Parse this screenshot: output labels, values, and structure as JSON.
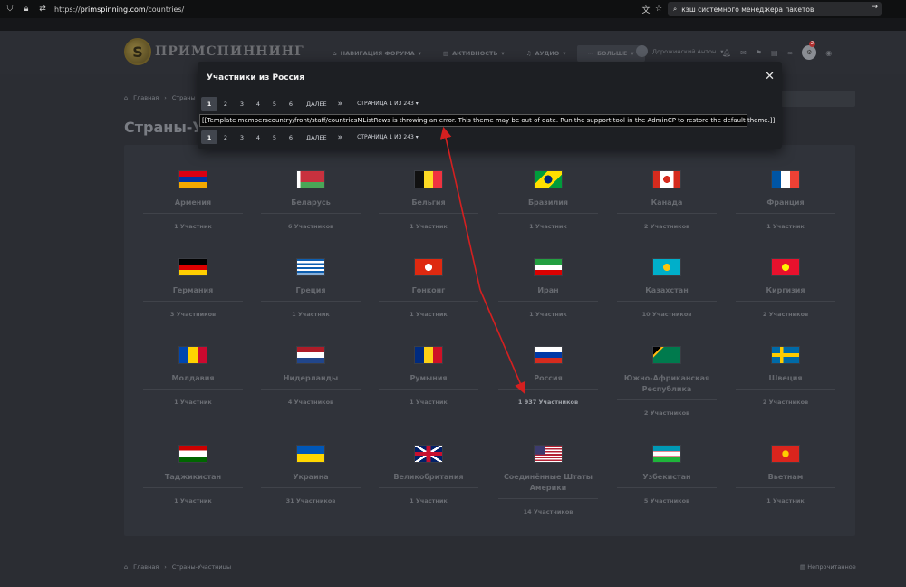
{
  "browser": {
    "url_prefix": "https://",
    "url_host": "primspinning.com",
    "url_path": "/countries/",
    "search_text": "кэш системного менеджера пакетов"
  },
  "site": {
    "logo_text": "ПРИМСПИННИНГ",
    "nav": [
      "НАВИГАЦИЯ ФОРУМА",
      "АКТИВНОСТЬ",
      "АУДИО",
      "БОЛЬШЕ"
    ],
    "user_name": "Дорожинский Антон",
    "badge_count": "2"
  },
  "breadcrumb": {
    "home": "Главная",
    "current": "Страны-Участницы",
    "partial": "Страны"
  },
  "page_title": "Страны-Уча",
  "modal": {
    "title": "Участники из Россия",
    "pages": [
      "1",
      "2",
      "3",
      "4",
      "5",
      "6"
    ],
    "next_label": "ДАЛЕЕ",
    "last_label": "»",
    "page_of": "СТРАНИЦА 1 ИЗ 243",
    "error": "[[Template memberscountry/front/staff/countriesMListRows is throwing an error. This theme may be out of date. Run the support tool in the AdminCP to restore the default theme.]]"
  },
  "countries": [
    {
      "name": "Армения",
      "count": "1 Участник"
    },
    {
      "name": "Беларусь",
      "count": "6 Участников"
    },
    {
      "name": "Бельгия",
      "count": "1 Участник"
    },
    {
      "name": "Бразилия",
      "count": "1 Участник"
    },
    {
      "name": "Канада",
      "count": "2 Участников"
    },
    {
      "name": "Франция",
      "count": "1 Участник"
    },
    {
      "name": "Германия",
      "count": "3 Участников"
    },
    {
      "name": "Греция",
      "count": "1 Участник"
    },
    {
      "name": "Гонконг",
      "count": "1 Участник"
    },
    {
      "name": "Иран",
      "count": "1 Участник"
    },
    {
      "name": "Казахстан",
      "count": "10 Участников"
    },
    {
      "name": "Киргизия",
      "count": "2 Участников"
    },
    {
      "name": "Молдавия",
      "count": "1 Участник"
    },
    {
      "name": "Нидерланды",
      "count": "4 Участников"
    },
    {
      "name": "Румыния",
      "count": "1 Участник"
    },
    {
      "name": "Россия",
      "count": "1 937 Участников"
    },
    {
      "name": "Южно-Африканская Республика",
      "count": "2 Участников"
    },
    {
      "name": "Швеция",
      "count": "2 Участников"
    },
    {
      "name": "Таджикистан",
      "count": "1 Участник"
    },
    {
      "name": "Украина",
      "count": "31 Участников"
    },
    {
      "name": "Великобритания",
      "count": "1 Участник"
    },
    {
      "name": "Соединённые Штаты Америки",
      "count": "14 Участников"
    },
    {
      "name": "Узбекистан",
      "count": "5 Участников"
    },
    {
      "name": "Вьетнам",
      "count": "1 Участник"
    }
  ],
  "footer": {
    "home": "Главная",
    "current": "Страны-Участницы",
    "right": "Непрочитанное"
  },
  "colors": {
    "annotation_arrow": "#d42020"
  }
}
